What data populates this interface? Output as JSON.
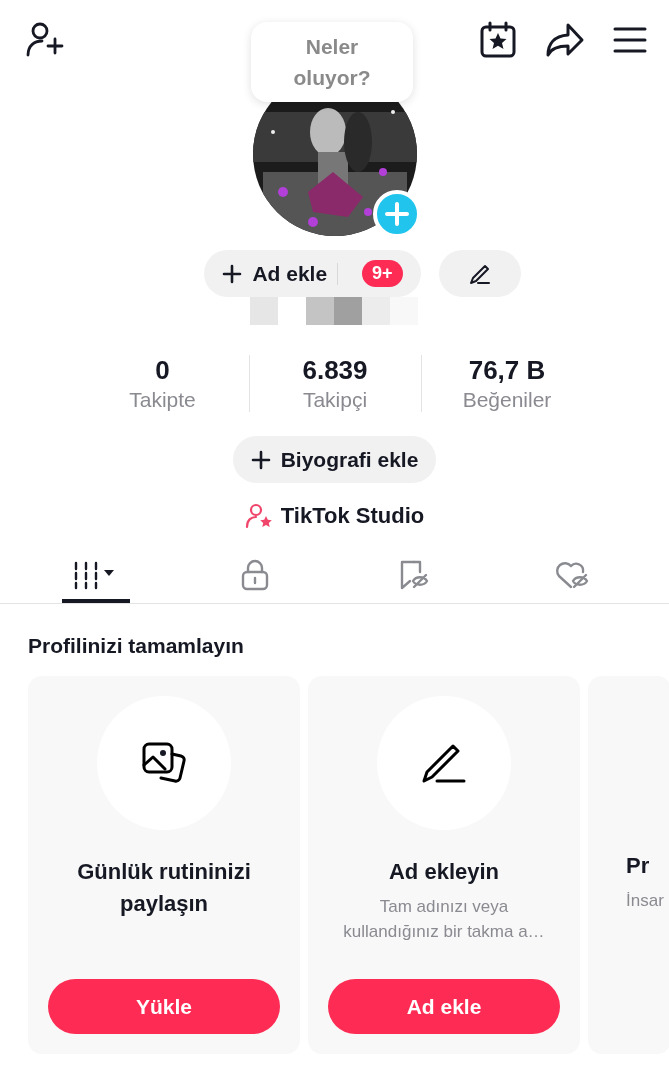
{
  "tooltip": {
    "text": "Neler oluyor?"
  },
  "name_button": {
    "label": "Ad ekle",
    "badge": "9+"
  },
  "stats": [
    {
      "value": "0",
      "label": "Takipte"
    },
    {
      "value": "6.839",
      "label": "Takipçi"
    },
    {
      "value": "76,7 B",
      "label": "Beğeniler"
    }
  ],
  "bio_button": {
    "label": "Biyografi ekle"
  },
  "studio_link": {
    "label": "TikTok Studio"
  },
  "tabs": [
    {
      "kind": "videos",
      "selected": true
    },
    {
      "kind": "private",
      "selected": false
    },
    {
      "kind": "saved",
      "selected": false
    },
    {
      "kind": "liked",
      "selected": false
    }
  ],
  "section_title": "Profilinizi tamamlayın",
  "cards": [
    {
      "kind": "photos",
      "title": "Günlük rutininizi paylaşın",
      "button": "Yükle"
    },
    {
      "kind": "pen",
      "title": "Ad ekleyin",
      "description": "Tam adınızı veya kullandığınız bir takma a…",
      "button": "Ad ekle"
    },
    {
      "kind": "partial",
      "title": "Pr",
      "description": "İnsar"
    }
  ]
}
